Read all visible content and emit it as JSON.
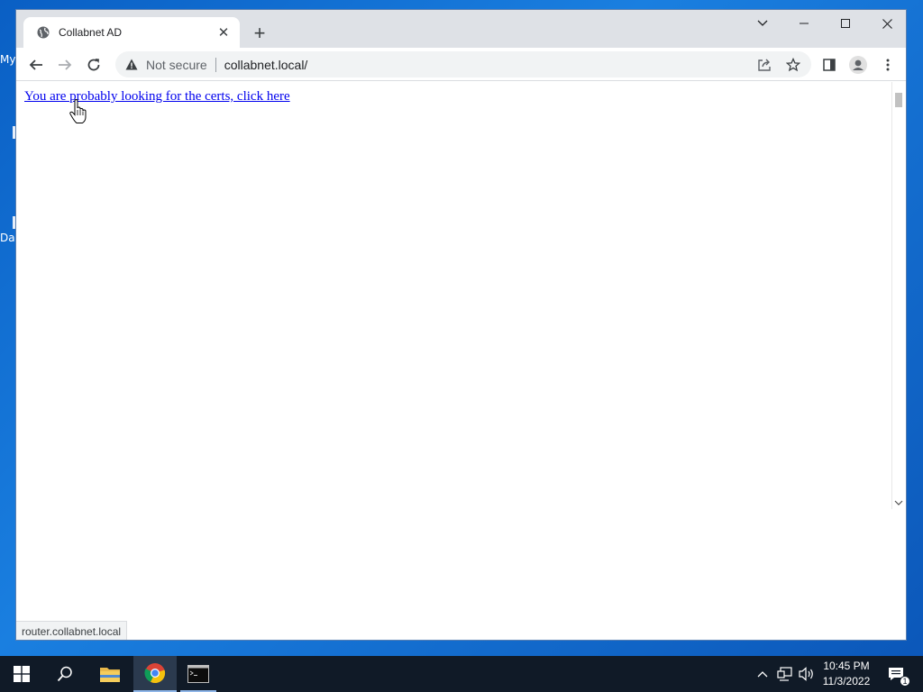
{
  "desktop": {
    "icon_fragments": [
      "My",
      "Da"
    ]
  },
  "browser": {
    "tab": {
      "title": "Collabnet AD",
      "favicon": "globe-icon",
      "close_glyph": "✕"
    },
    "new_tab_glyph": "+",
    "toolbar": {
      "security_label": "Not secure",
      "url": "collabnet.local/"
    },
    "page": {
      "link_text": "You are probably looking for the certs, click here"
    },
    "status_bar": {
      "hover_url": "router.collabnet.local"
    }
  },
  "taskbar": {
    "apps": [
      "windows-start",
      "search",
      "file-explorer",
      "chrome",
      "command-prompt"
    ],
    "clock": {
      "time": "10:45 PM",
      "date": "11/3/2022"
    },
    "notification_count": "1"
  },
  "colors": {
    "desktop": "#0a5fc4",
    "taskbar": "#101a27",
    "link": "#0000ee",
    "titlebar": "#dee1e6",
    "omnibox": "#f1f3f4"
  }
}
